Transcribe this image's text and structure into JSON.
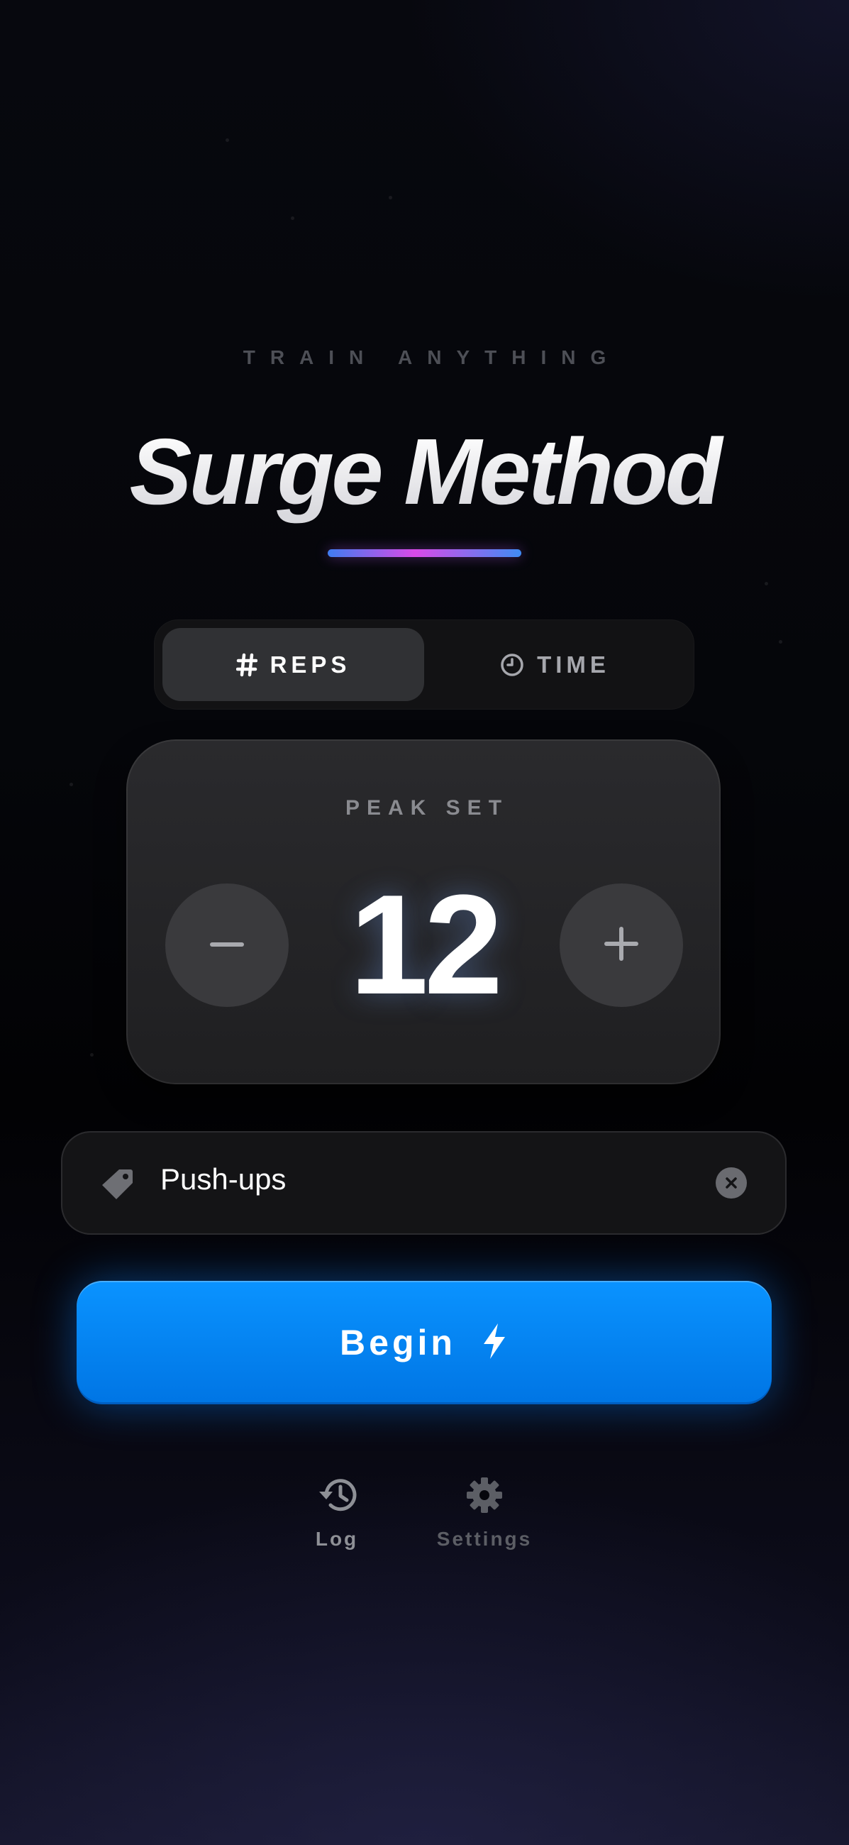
{
  "header": {
    "eyebrow": "TRAIN ANYTHING",
    "title": "Surge Method"
  },
  "mode_toggle": {
    "options": [
      {
        "label": "REPS",
        "icon": "hash-icon",
        "selected": true
      },
      {
        "label": "TIME",
        "icon": "clock-icon",
        "selected": false
      }
    ]
  },
  "counter": {
    "label": "PEAK SET",
    "value": "12",
    "decrement_icon": "minus-icon",
    "increment_icon": "plus-icon"
  },
  "exercise_field": {
    "value": "Push-ups",
    "icon": "tag-icon",
    "clear_icon": "clear-icon"
  },
  "primary_action": {
    "label": "Begin",
    "icon": "lightning-icon",
    "color": "#0a8cff"
  },
  "bottom_nav": {
    "items": [
      {
        "label": "Log",
        "icon": "history-icon"
      },
      {
        "label": "Settings",
        "icon": "gear-icon"
      }
    ]
  },
  "colors": {
    "accent_blue": "#0a8cff",
    "underline_gradient": [
      "#3f7cf0",
      "#d94ae8",
      "#3f8cf4"
    ]
  }
}
